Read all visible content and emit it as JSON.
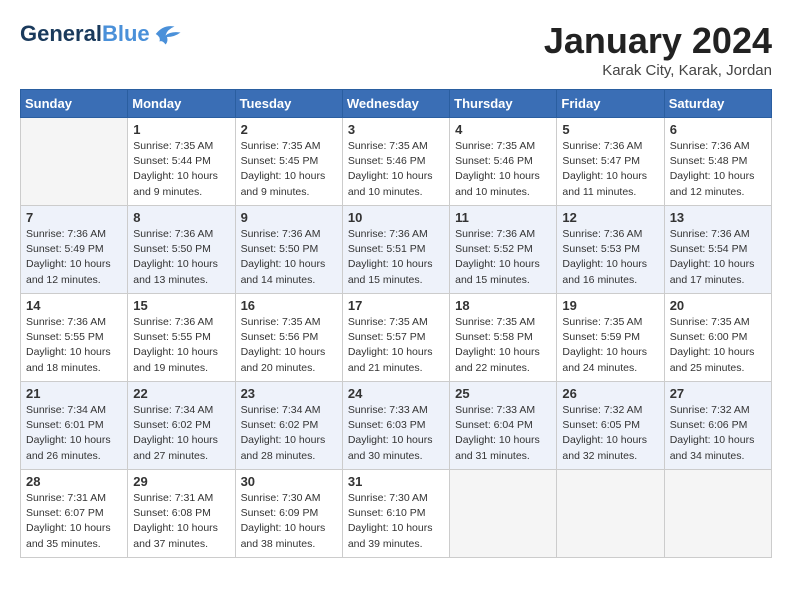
{
  "header": {
    "logo_line1": "General",
    "logo_line2": "Blue",
    "month": "January 2024",
    "location": "Karak City, Karak, Jordan"
  },
  "weekdays": [
    "Sunday",
    "Monday",
    "Tuesday",
    "Wednesday",
    "Thursday",
    "Friday",
    "Saturday"
  ],
  "weeks": [
    [
      {
        "day": "",
        "info": ""
      },
      {
        "day": "1",
        "info": "Sunrise: 7:35 AM\nSunset: 5:44 PM\nDaylight: 10 hours\nand 9 minutes."
      },
      {
        "day": "2",
        "info": "Sunrise: 7:35 AM\nSunset: 5:45 PM\nDaylight: 10 hours\nand 9 minutes."
      },
      {
        "day": "3",
        "info": "Sunrise: 7:35 AM\nSunset: 5:46 PM\nDaylight: 10 hours\nand 10 minutes."
      },
      {
        "day": "4",
        "info": "Sunrise: 7:35 AM\nSunset: 5:46 PM\nDaylight: 10 hours\nand 10 minutes."
      },
      {
        "day": "5",
        "info": "Sunrise: 7:36 AM\nSunset: 5:47 PM\nDaylight: 10 hours\nand 11 minutes."
      },
      {
        "day": "6",
        "info": "Sunrise: 7:36 AM\nSunset: 5:48 PM\nDaylight: 10 hours\nand 12 minutes."
      }
    ],
    [
      {
        "day": "7",
        "info": "Sunrise: 7:36 AM\nSunset: 5:49 PM\nDaylight: 10 hours\nand 12 minutes."
      },
      {
        "day": "8",
        "info": "Sunrise: 7:36 AM\nSunset: 5:50 PM\nDaylight: 10 hours\nand 13 minutes."
      },
      {
        "day": "9",
        "info": "Sunrise: 7:36 AM\nSunset: 5:50 PM\nDaylight: 10 hours\nand 14 minutes."
      },
      {
        "day": "10",
        "info": "Sunrise: 7:36 AM\nSunset: 5:51 PM\nDaylight: 10 hours\nand 15 minutes."
      },
      {
        "day": "11",
        "info": "Sunrise: 7:36 AM\nSunset: 5:52 PM\nDaylight: 10 hours\nand 15 minutes."
      },
      {
        "day": "12",
        "info": "Sunrise: 7:36 AM\nSunset: 5:53 PM\nDaylight: 10 hours\nand 16 minutes."
      },
      {
        "day": "13",
        "info": "Sunrise: 7:36 AM\nSunset: 5:54 PM\nDaylight: 10 hours\nand 17 minutes."
      }
    ],
    [
      {
        "day": "14",
        "info": "Sunrise: 7:36 AM\nSunset: 5:55 PM\nDaylight: 10 hours\nand 18 minutes."
      },
      {
        "day": "15",
        "info": "Sunrise: 7:36 AM\nSunset: 5:55 PM\nDaylight: 10 hours\nand 19 minutes."
      },
      {
        "day": "16",
        "info": "Sunrise: 7:35 AM\nSunset: 5:56 PM\nDaylight: 10 hours\nand 20 minutes."
      },
      {
        "day": "17",
        "info": "Sunrise: 7:35 AM\nSunset: 5:57 PM\nDaylight: 10 hours\nand 21 minutes."
      },
      {
        "day": "18",
        "info": "Sunrise: 7:35 AM\nSunset: 5:58 PM\nDaylight: 10 hours\nand 22 minutes."
      },
      {
        "day": "19",
        "info": "Sunrise: 7:35 AM\nSunset: 5:59 PM\nDaylight: 10 hours\nand 24 minutes."
      },
      {
        "day": "20",
        "info": "Sunrise: 7:35 AM\nSunset: 6:00 PM\nDaylight: 10 hours\nand 25 minutes."
      }
    ],
    [
      {
        "day": "21",
        "info": "Sunrise: 7:34 AM\nSunset: 6:01 PM\nDaylight: 10 hours\nand 26 minutes."
      },
      {
        "day": "22",
        "info": "Sunrise: 7:34 AM\nSunset: 6:02 PM\nDaylight: 10 hours\nand 27 minutes."
      },
      {
        "day": "23",
        "info": "Sunrise: 7:34 AM\nSunset: 6:02 PM\nDaylight: 10 hours\nand 28 minutes."
      },
      {
        "day": "24",
        "info": "Sunrise: 7:33 AM\nSunset: 6:03 PM\nDaylight: 10 hours\nand 30 minutes."
      },
      {
        "day": "25",
        "info": "Sunrise: 7:33 AM\nSunset: 6:04 PM\nDaylight: 10 hours\nand 31 minutes."
      },
      {
        "day": "26",
        "info": "Sunrise: 7:32 AM\nSunset: 6:05 PM\nDaylight: 10 hours\nand 32 minutes."
      },
      {
        "day": "27",
        "info": "Sunrise: 7:32 AM\nSunset: 6:06 PM\nDaylight: 10 hours\nand 34 minutes."
      }
    ],
    [
      {
        "day": "28",
        "info": "Sunrise: 7:31 AM\nSunset: 6:07 PM\nDaylight: 10 hours\nand 35 minutes."
      },
      {
        "day": "29",
        "info": "Sunrise: 7:31 AM\nSunset: 6:08 PM\nDaylight: 10 hours\nand 37 minutes."
      },
      {
        "day": "30",
        "info": "Sunrise: 7:30 AM\nSunset: 6:09 PM\nDaylight: 10 hours\nand 38 minutes."
      },
      {
        "day": "31",
        "info": "Sunrise: 7:30 AM\nSunset: 6:10 PM\nDaylight: 10 hours\nand 39 minutes."
      },
      {
        "day": "",
        "info": ""
      },
      {
        "day": "",
        "info": ""
      },
      {
        "day": "",
        "info": ""
      }
    ]
  ]
}
